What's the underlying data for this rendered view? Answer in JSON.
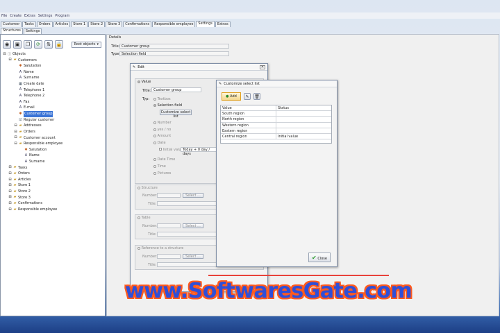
{
  "menu": [
    "File",
    "Create",
    "Extras",
    "Settings",
    "Program"
  ],
  "main_tabs": [
    "Customer",
    "Tasks",
    "Orders",
    "Articles",
    "Store 1",
    "Store 2",
    "Store 3",
    "Confirmations",
    "Responsible employee",
    "Settings",
    "Extras"
  ],
  "active_main_tab": "Settings",
  "sub_tabs": [
    "Structures",
    "Settings"
  ],
  "toolbar": {
    "root_objects": "Root objects"
  },
  "tree": [
    {
      "label": "Objects",
      "level": 0,
      "icon": "objects-icon"
    },
    {
      "label": "Customers",
      "level": 1,
      "icon": "folder-icon"
    },
    {
      "label": "Salutation",
      "level": 2,
      "icon": "list-icon"
    },
    {
      "label": "Name",
      "level": 2,
      "icon": "text-icon"
    },
    {
      "label": "Surname",
      "level": 2,
      "icon": "text-icon"
    },
    {
      "label": "Create date",
      "level": 2,
      "icon": "calendar-icon"
    },
    {
      "label": "Telephone 1",
      "level": 2,
      "icon": "text-icon"
    },
    {
      "label": "Telephone 2",
      "level": 2,
      "icon": "text-icon"
    },
    {
      "label": "Fax",
      "level": 2,
      "icon": "text-icon"
    },
    {
      "label": "E-mail",
      "level": 2,
      "icon": "text-icon"
    },
    {
      "label": "Customer group",
      "level": 2,
      "icon": "list-icon",
      "selected": true
    },
    {
      "label": "Regular customer",
      "level": 2,
      "icon": "checkbox-icon"
    },
    {
      "label": "Addresses",
      "level": 2,
      "icon": "folder-icon"
    },
    {
      "label": "Orders",
      "level": 2,
      "icon": "folder-icon"
    },
    {
      "label": "Customer account",
      "level": 2,
      "icon": "folder-icon"
    },
    {
      "label": "Responsible employee",
      "level": 2,
      "icon": "folder-icon"
    },
    {
      "label": "Salutation",
      "level": 3,
      "icon": "list-icon"
    },
    {
      "label": "Name",
      "level": 3,
      "icon": "text-icon"
    },
    {
      "label": "Surname",
      "level": 3,
      "icon": "text-icon"
    },
    {
      "label": "Tasks",
      "level": 1,
      "icon": "folder-icon"
    },
    {
      "label": "Orders",
      "level": 1,
      "icon": "folder-icon"
    },
    {
      "label": "Articles",
      "level": 1,
      "icon": "folder-icon"
    },
    {
      "label": "Store 1",
      "level": 1,
      "icon": "folder-icon"
    },
    {
      "label": "Store 2",
      "level": 1,
      "icon": "folder-icon"
    },
    {
      "label": "Store 3",
      "level": 1,
      "icon": "folder-icon"
    },
    {
      "label": "Confirmations",
      "level": 1,
      "icon": "folder-icon"
    },
    {
      "label": "Responsible employee",
      "level": 1,
      "icon": "folder-icon"
    }
  ],
  "details": {
    "label": "Details",
    "title_label": "Title:",
    "title_value": "Customer group",
    "type_label": "Type:",
    "type_value": "Selection field"
  },
  "edit": {
    "title": "Edit",
    "value_label": "Value",
    "title_label": "Title:",
    "title_value": "Customer group",
    "typ_label": "Typ:",
    "types": [
      "Textbox",
      "Selection field",
      "Number",
      "yes / no",
      "Amount",
      "Date",
      "Date Time",
      "Time",
      "Pictures"
    ],
    "customize_btn": "Customize select list",
    "initial_label": "Initial value:",
    "initial_value": "Today + 0 day / days",
    "structure": {
      "label": "Structure",
      "number": "Number:",
      "select": "Select ...",
      "title": "Title:"
    },
    "table": {
      "label": "Table",
      "number": "Number:",
      "select": "Select ...",
      "title": "Title:"
    },
    "ref": {
      "label": "Reference to a structure",
      "number": "Number:",
      "select": "Select ...",
      "title": "Title:"
    }
  },
  "customize": {
    "title": "Customize select list",
    "add": "Add",
    "headers": [
      "Value",
      "Status"
    ],
    "rows": [
      [
        "South region",
        ""
      ],
      [
        "North region",
        ""
      ],
      [
        "Western region",
        ""
      ],
      [
        "Eastern region",
        ""
      ],
      [
        "Central region",
        "Initial value"
      ]
    ],
    "close": "Close"
  },
  "watermark": "www.SoftwaresGate.com"
}
